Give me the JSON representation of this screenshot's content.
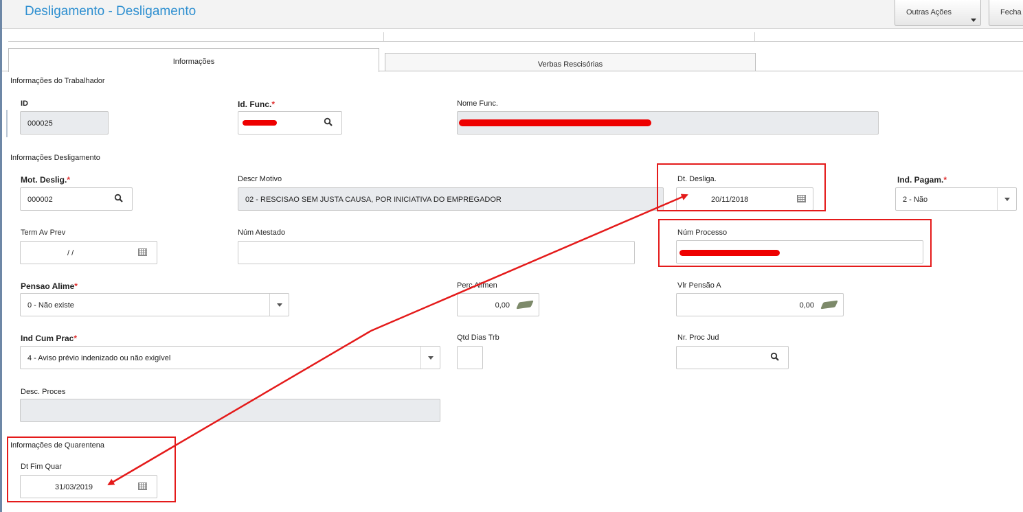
{
  "header": {
    "title": "Desligamento - Desligamento",
    "buttons": {
      "outras_acoes": "Outras Ações",
      "fechar": "Fecha"
    }
  },
  "tabs": [
    {
      "label": "Informações",
      "active": true
    },
    {
      "label": "Verbas Rescisórias",
      "active": false
    }
  ],
  "trabalhador": {
    "section_title": "Informações do Trabalhador",
    "id_label": "ID",
    "id_value": "000025",
    "id_func_label": "Id. Func.",
    "nome_func_label": "Nome Func."
  },
  "desligamento": {
    "section_title": "Informações Desligamento",
    "mot_deslig_label": "Mot. Deslig.",
    "mot_deslig_value": "000002",
    "descr_motivo_label": "Descr Motivo",
    "descr_motivo_value": "02 - RESCISAO SEM JUSTA CAUSA, POR INICIATIVA DO EMPREGADOR",
    "dt_desliga_label": "Dt. Desliga.",
    "dt_desliga_value": "20/11/2018",
    "ind_pagam_label": "Ind. Pagam.",
    "ind_pagam_value": "2 - Não",
    "term_av_prev_label": "Term Av Prev",
    "term_av_prev_value": "/ /",
    "num_atestado_label": "Núm Atestado",
    "num_processo_label": "Núm Processo",
    "pensao_alime_label": "Pensao Alime",
    "pensao_alime_value": "0 - Não existe",
    "perc_alimen_label": "Perc Alimen",
    "perc_alimen_value": "0,00",
    "vlr_pensao_label": "Vlr Pensão A",
    "vlr_pensao_value": "0,00",
    "ind_cum_prac_label": "Ind Cum Prac",
    "ind_cum_prac_value": "4 - Aviso prévio indenizado ou não exigível",
    "qtd_dias_trb_label": "Qtd Dias Trb",
    "nr_proc_jud_label": "Nr. Proc Jud",
    "desc_proces_label": "Desc. Proces"
  },
  "quarentena": {
    "section_title": "Informações de Quarentena",
    "dt_fim_quar_label": "Dt Fim Quar",
    "dt_fim_quar_value": "31/03/2019"
  },
  "annotation_color": "#e41a1a"
}
